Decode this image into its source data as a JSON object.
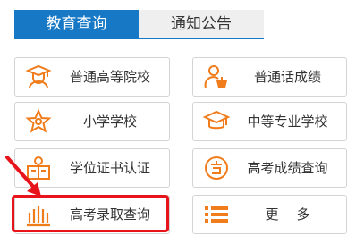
{
  "tabs": [
    {
      "label": "教育查询",
      "active": true
    },
    {
      "label": "通知公告",
      "active": false
    }
  ],
  "tiles": [
    {
      "label": "普通高等院校",
      "icon": "graduate-icon"
    },
    {
      "label": "普通话成绩",
      "icon": "speaker-person-icon"
    },
    {
      "label": "小学学校",
      "icon": "star-badge-icon"
    },
    {
      "label": "中等专业学校",
      "icon": "mortarboard-icon"
    },
    {
      "label": "学位证书认证",
      "icon": "diploma-icon"
    },
    {
      "label": "高考成绩查询",
      "icon": "exam-score-icon"
    },
    {
      "label": "高考录取查询",
      "icon": "bar-chart-icon"
    },
    {
      "label": "更多",
      "icon": "list-icon"
    }
  ],
  "colors": {
    "accent": "#1779c6",
    "icon": "#f07c1b",
    "highlight": "#e8141b"
  }
}
